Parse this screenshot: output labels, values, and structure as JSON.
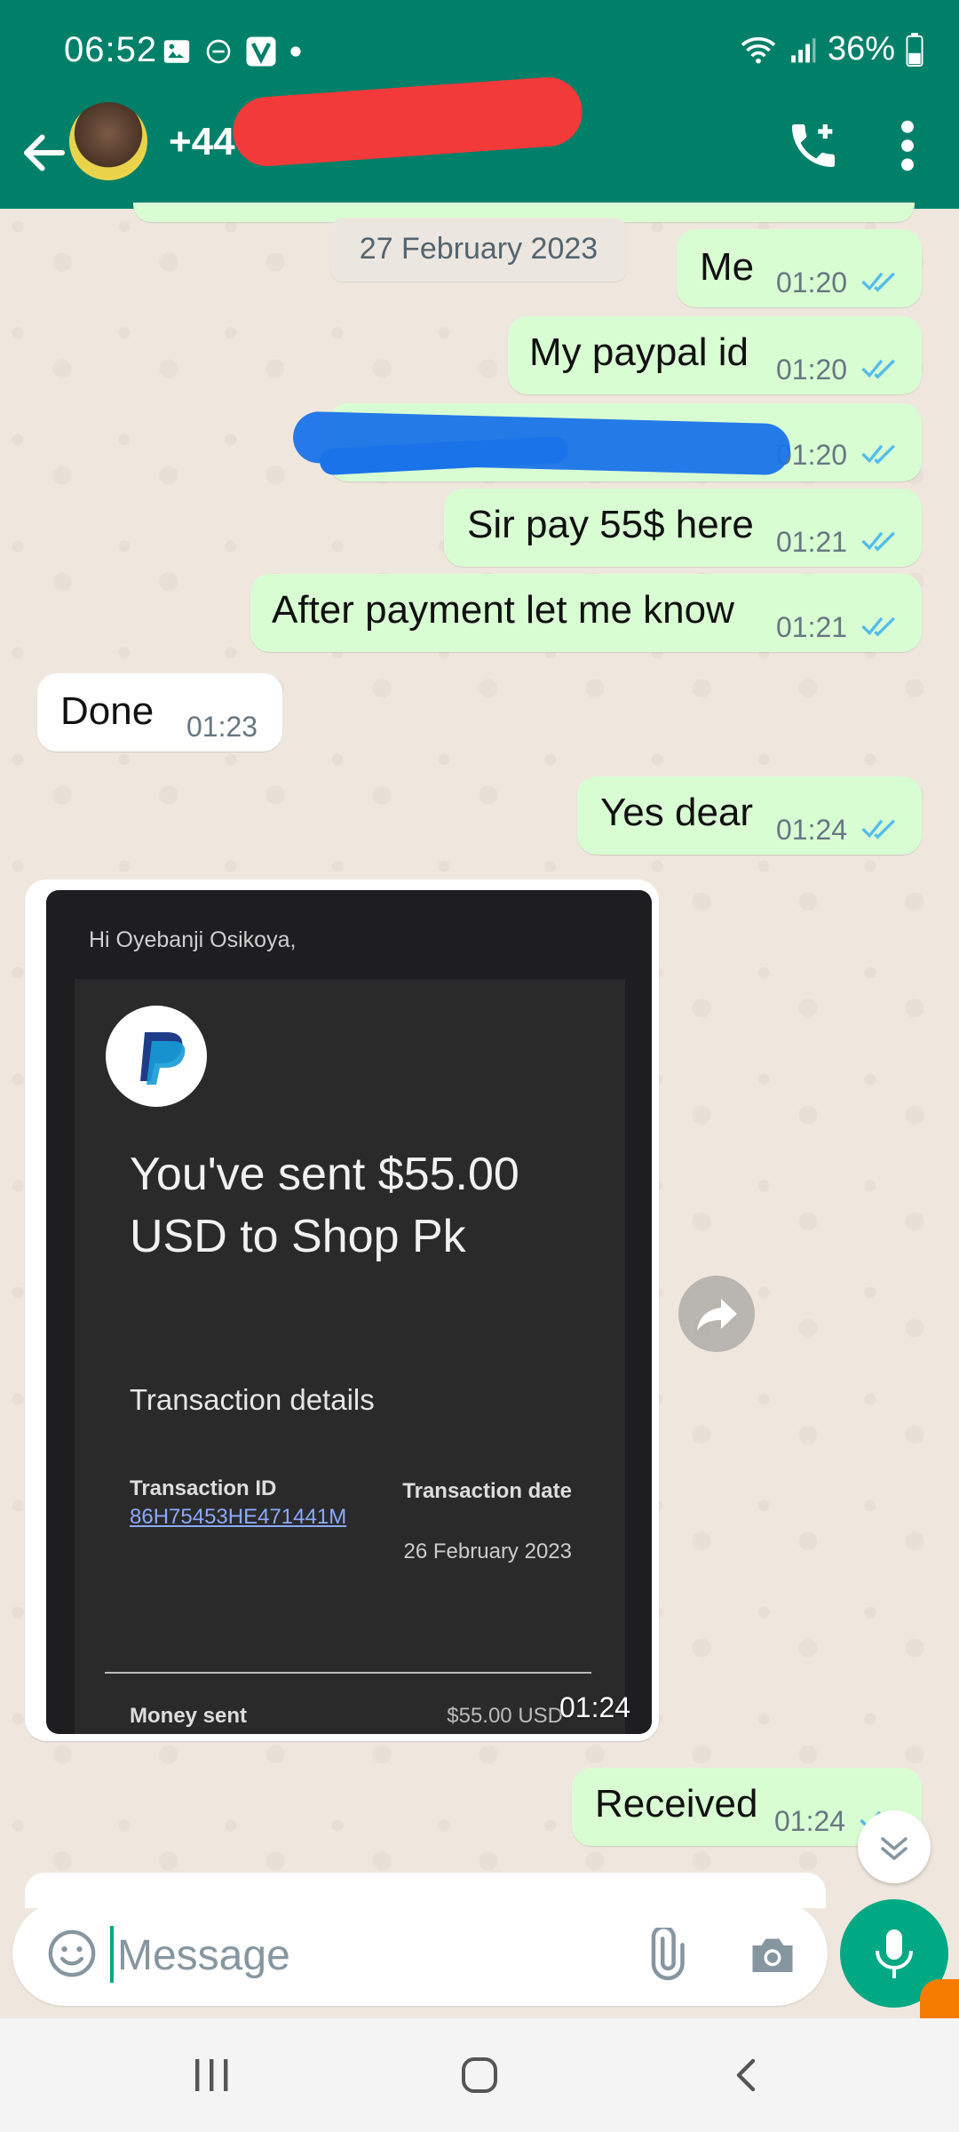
{
  "status_bar": {
    "time": "06:52",
    "battery": "36%"
  },
  "header": {
    "contact_prefix": "+44"
  },
  "chat": {
    "date_chip": "27 February 2023",
    "messages": [
      {
        "text": "Me",
        "time": "01:20",
        "direction": "outgoing"
      },
      {
        "text": "My paypal id",
        "time": "01:20",
        "direction": "outgoing"
      },
      {
        "text": "",
        "time": "01:20",
        "direction": "outgoing"
      },
      {
        "text": "Sir pay 55$ here",
        "time": "01:21",
        "direction": "outgoing"
      },
      {
        "text": "After payment let me know",
        "time": "01:21",
        "direction": "outgoing"
      },
      {
        "text": "Done",
        "time": "01:23",
        "direction": "incoming"
      },
      {
        "text": "Yes dear",
        "time": "01:24",
        "direction": "outgoing"
      },
      {
        "text": "Received",
        "time": "01:24",
        "direction": "outgoing"
      }
    ],
    "image_message": {
      "time": "01:24",
      "greeting": "Hi Oyebanji Osikoya,",
      "headline": "You've sent $55.00 USD to Shop Pk",
      "details_heading": "Transaction details",
      "transaction_id_label": "Transaction ID",
      "transaction_id": "86H75453HE471441M",
      "transaction_date_label": "Transaction date",
      "transaction_date": "26 February 2023",
      "money_sent_label": "Money sent",
      "money_sent": "$55.00 USD"
    }
  },
  "input": {
    "placeholder": "Message"
  },
  "colors": {
    "header": "#008069",
    "outgoing_bubble": "#d9fdd3",
    "incoming_bubble": "#ffffff",
    "accent": "#00a884",
    "read_ticks": "#53bdeb"
  }
}
